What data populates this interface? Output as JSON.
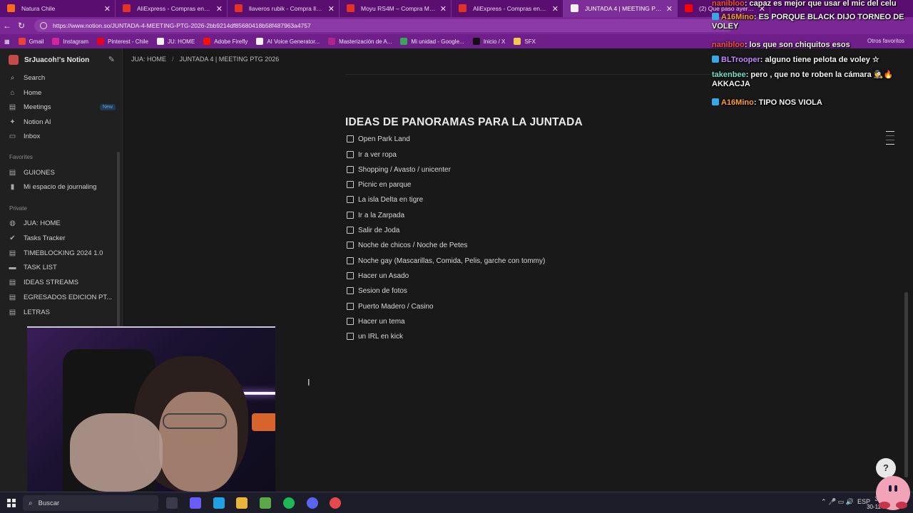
{
  "browser": {
    "tabs": [
      {
        "label": "Natura Chile",
        "color": "#ff6a1a",
        "active": false
      },
      {
        "label": "AliExpress - Compras en línea pa",
        "color": "#e43225",
        "active": false
      },
      {
        "label": "llaveros rubik - Compra llaveros",
        "color": "#e43225",
        "active": false
      },
      {
        "label": "Moyu RS4M – Compra Moyu RS4",
        "color": "#e43225",
        "active": false
      },
      {
        "label": "AliExpress - Compras en línea pa",
        "color": "#e43225",
        "active": false
      },
      {
        "label": "JUNTADA 4 | MEETING PTG 2026",
        "color": "#f2f2f2",
        "active": true
      },
      {
        "label": "(2) Que paso ayer: Meme materi",
        "color": "#ff0000",
        "active": false
      }
    ],
    "url": "https://www.notion.so/JUNTADA-4-MEETING-PTG-2026-2bb9214df85680418b58f487963a4757",
    "bookmarks": [
      {
        "label": "Gmail",
        "color": "#ea4335"
      },
      {
        "label": "Instagram",
        "color": "#d6249f"
      },
      {
        "label": "Pinterest - Chile",
        "color": "#e60023"
      },
      {
        "label": "JU: HOME",
        "color": "#f2f2f2"
      },
      {
        "label": "Adobe Firefly",
        "color": "#fa0f00"
      },
      {
        "label": "AI Voice Generator...",
        "color": "#f2f2f2"
      },
      {
        "label": "Masterización de A...",
        "color": "#b0228c"
      },
      {
        "label": "Mi unidad - Google...",
        "color": "#34a853"
      },
      {
        "label": "Inicio / X",
        "color": "#111111"
      },
      {
        "label": "SFX",
        "color": "#f2c94c"
      }
    ],
    "other_bookmarks": "Otros favoritos"
  },
  "sidebar": {
    "workspace": "SrJuacoh!'s Notion",
    "top_items": [
      {
        "label": "Search",
        "icon": "search-icon",
        "glyph": "⌕"
      },
      {
        "label": "Home",
        "icon": "home-icon",
        "glyph": "⌂"
      },
      {
        "label": "Meetings",
        "icon": "meetings-icon",
        "glyph": "▤",
        "badge": "New"
      },
      {
        "label": "Notion AI",
        "icon": "notion-ai-icon",
        "glyph": "✦"
      },
      {
        "label": "Inbox",
        "icon": "inbox-icon",
        "glyph": "▭"
      }
    ],
    "favorites_heading": "Favorites",
    "favorites": [
      {
        "label": "GUIONES",
        "icon": "page-icon",
        "glyph": "▤"
      },
      {
        "label": "Mi espacio de journaling",
        "icon": "journal-icon",
        "glyph": "▮"
      }
    ],
    "private_heading": "Private",
    "private": [
      {
        "label": "JUA: HOME",
        "icon": "globe-icon",
        "glyph": "◍"
      },
      {
        "label": "Tasks Tracker",
        "icon": "check-circle-icon",
        "glyph": "✔"
      },
      {
        "label": "TIMEBLOCKING 2024 1.0",
        "icon": "page-icon",
        "glyph": "▤"
      },
      {
        "label": "TASK LIST",
        "icon": "flag-icon",
        "glyph": "▬"
      },
      {
        "label": "IDEAS STREAMS",
        "icon": "page-icon",
        "glyph": "▤"
      },
      {
        "label": "EGRESADOS EDICION PT...",
        "icon": "page-icon",
        "glyph": "▤"
      },
      {
        "label": "LETRAS",
        "icon": "page-icon",
        "glyph": "▤"
      }
    ]
  },
  "page": {
    "breadcrumb": [
      "JUA: HOME",
      "JUNTADA 4 | MEETING PTG 2026"
    ],
    "heading": "IDEAS DE PANORAMAS PARA LA JUNTADA",
    "todos": [
      "Open Park Land",
      "Ir a ver ropa",
      "Shopping / Avasto / unicenter",
      "Picnic en parque",
      "La isla Delta en tigre",
      "Ir a la Zarpada",
      "Salir de Joda",
      "Noche de chicos / Noche de Petes",
      "Noche gay (Mascarillas, Comida, Pelis, garche con tommy)",
      "Hacer un Asado",
      "Sesion de fotos",
      "Puerto Madero / Casino",
      "Hacer un tema",
      "un IRL en kick"
    ],
    "help": "?"
  },
  "chat": [
    {
      "user": "nanibloo",
      "text": ": capaz es mejor que usar el mic del celu",
      "color": "#ff4a4a",
      "badge": false
    },
    {
      "user": "A16Mino",
      "text": ": ES PORQUE BLACK DIJO TORNEO DE VOLEY",
      "color": "#ff9f2e",
      "badge": true
    },
    {
      "user": "nanibloo",
      "text": ": los que son chiquitos esos",
      "color": "#ff4a4a",
      "badge": false
    },
    {
      "user": "BLTrooper",
      "text": ": alguno tiene pelota de voley ☆",
      "color": "#c487ff",
      "badge": true
    },
    {
      "user": "takenbee",
      "text": ": pero , que no te roben la cámara 🕵🔥 AKKACJA",
      "color": "#6fe0c8",
      "badge": false
    },
    {
      "user": "A16Mino",
      "text": ": TIPO NOS VIOLA",
      "color": "#ff9f2e",
      "badge": true
    }
  ],
  "taskbar": {
    "search": "Buscar",
    "lang": "ESP",
    "time": "3:04",
    "date": "30-11-2"
  }
}
